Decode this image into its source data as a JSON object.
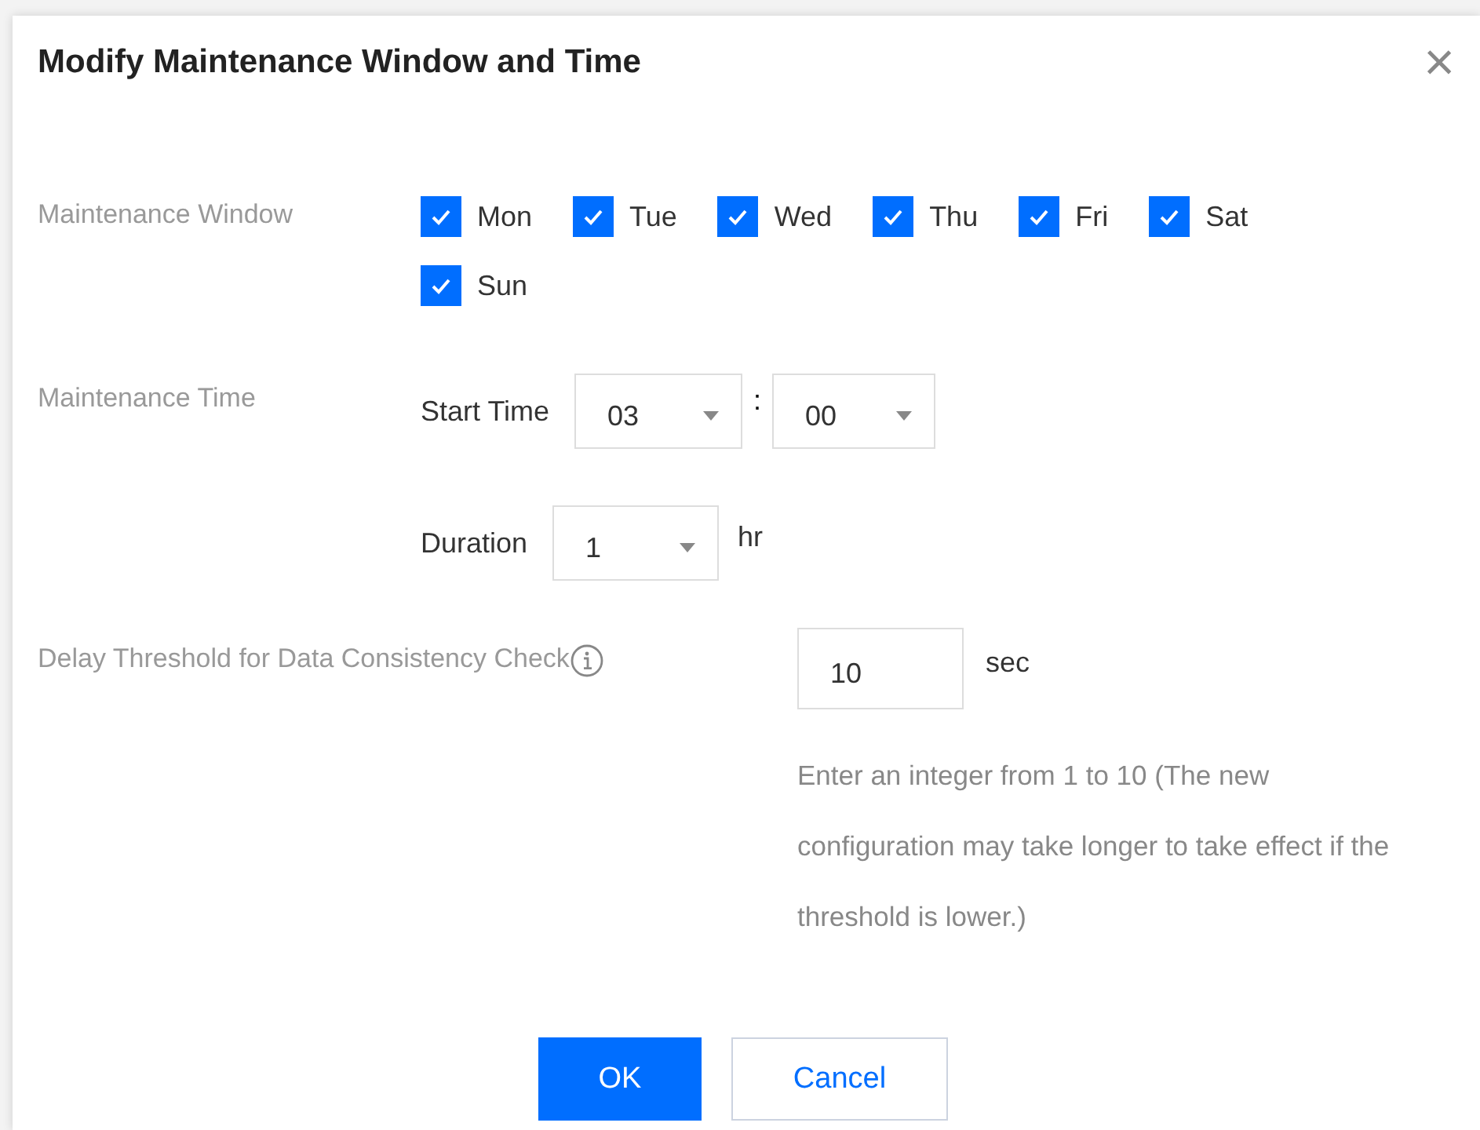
{
  "dialog": {
    "title": "Modify Maintenance Window and Time",
    "close": "×"
  },
  "maintenance_window": {
    "label": "Maintenance Window",
    "days": [
      {
        "label": "Mon",
        "checked": true
      },
      {
        "label": "Tue",
        "checked": true
      },
      {
        "label": "Wed",
        "checked": true
      },
      {
        "label": "Thu",
        "checked": true
      },
      {
        "label": "Fri",
        "checked": true
      },
      {
        "label": "Sat",
        "checked": true
      },
      {
        "label": "Sun",
        "checked": true
      }
    ]
  },
  "maintenance_time": {
    "label": "Maintenance Time",
    "start_label": "Start Time",
    "hour": "03",
    "separator": ":",
    "minute": "00",
    "duration_label": "Duration",
    "duration": "1",
    "duration_unit": "hr"
  },
  "delay_threshold": {
    "label": "Delay Threshold for Data Consistency Check",
    "value": "10",
    "unit": "sec",
    "hint": "Enter an integer from 1 to 10 (The new configuration may take longer to take effect if the threshold is lower.)"
  },
  "buttons": [
    {
      "label": "OK",
      "kind": "primary"
    },
    {
      "label": "Cancel",
      "kind": "secondary"
    }
  ]
}
